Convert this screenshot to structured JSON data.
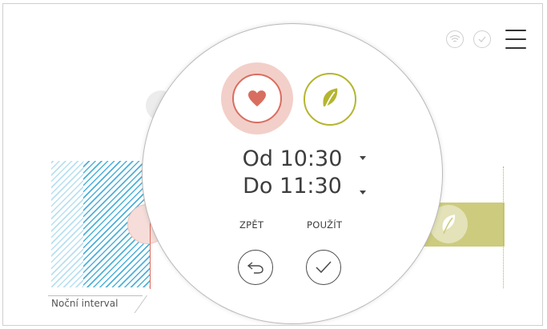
{
  "header": {
    "icons": [
      "wifi-icon",
      "check-bubble-icon",
      "menu-icon"
    ]
  },
  "timeline": {
    "night_label": "Noční interval"
  },
  "modal": {
    "types": [
      "heart-icon",
      "leaf-icon"
    ],
    "from_label": "Od 10:30",
    "to_label": "Do 11:30",
    "back_label": "ZPĚT",
    "apply_label": "POUŽÍT",
    "back_icon": "undo-arrow-icon",
    "apply_icon": "checkmark-icon"
  },
  "colors": {
    "heart_accent": "#d86e60",
    "heart_halo": "#f3cfc9",
    "leaf_accent": "#b5b531",
    "night_hatch": "#39a7d6",
    "olive_bar": "#cdcb7e"
  }
}
